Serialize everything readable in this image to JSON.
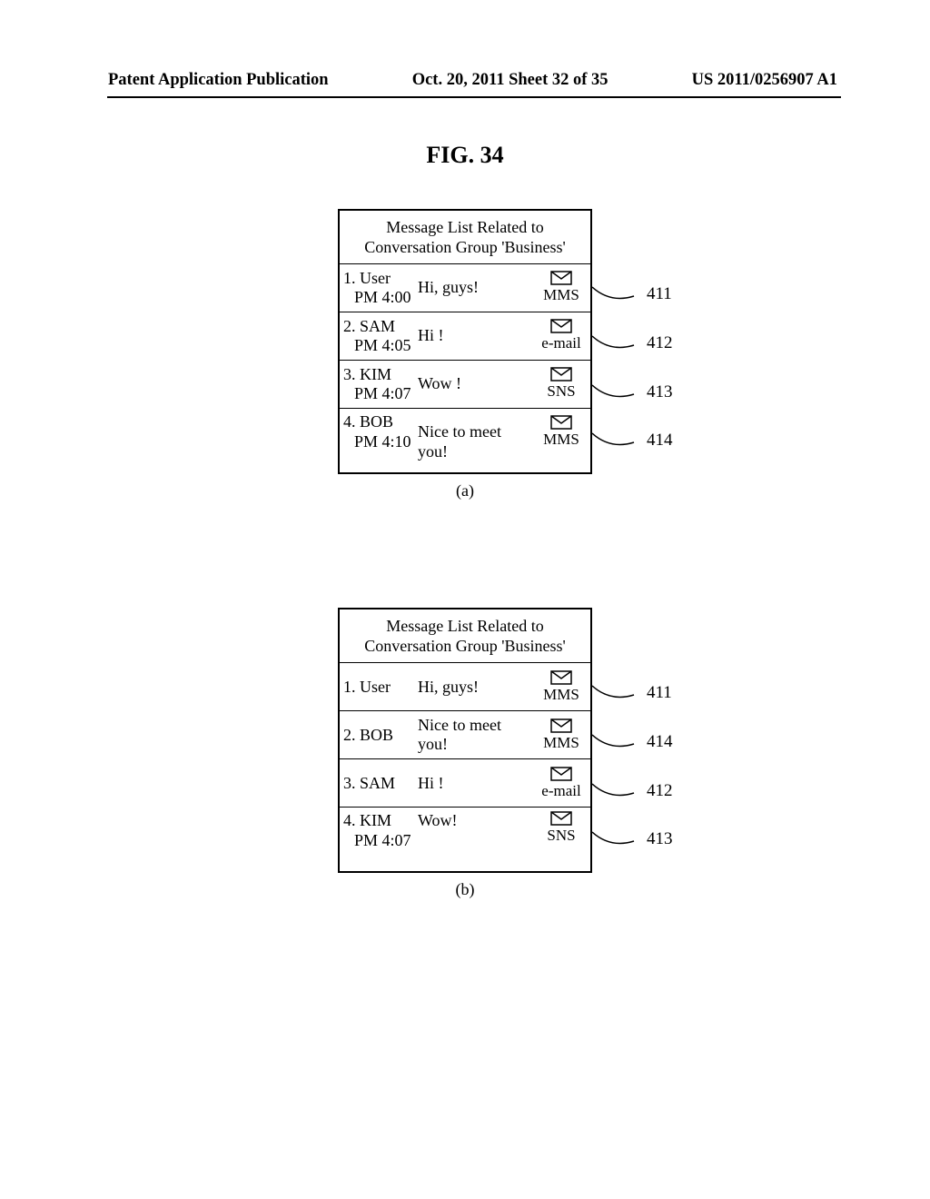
{
  "header": {
    "left": "Patent Application Publication",
    "center": "Oct. 20, 2011  Sheet 32 of 35",
    "right": "US 2011/0256907 A1"
  },
  "figure_label": "FIG. 34",
  "panels": {
    "a": {
      "title_line1": "Message List Related to",
      "title_line2": "Conversation Group 'Business'",
      "rows": [
        {
          "sender": "1. User",
          "time": "PM 4:00",
          "msg": "Hi, guys!",
          "type": "MMS",
          "ref": "411"
        },
        {
          "sender": "2. SAM",
          "time": "PM 4:05",
          "msg": "Hi !",
          "type": "e-mail",
          "ref": "412"
        },
        {
          "sender": "3. KIM",
          "time": "PM 4:07",
          "msg": "Wow !",
          "type": "SNS",
          "ref": "413"
        },
        {
          "sender": "4. BOB",
          "time": "PM 4:10",
          "msg": "Nice to meet you!",
          "type": "MMS",
          "ref": "414"
        }
      ],
      "sublabel": "(a)"
    },
    "b": {
      "title_line1": "Message List Related to",
      "title_line2": "Conversation Group 'Business'",
      "rows": [
        {
          "sender": "1. User",
          "time": "",
          "msg": "Hi, guys!",
          "type": "MMS",
          "ref": "411"
        },
        {
          "sender": "2. BOB",
          "time": "",
          "msg": "Nice to meet you!",
          "type": "MMS",
          "ref": "414"
        },
        {
          "sender": "3. SAM",
          "time": "",
          "msg": "Hi !",
          "type": "e-mail",
          "ref": "412"
        },
        {
          "sender": "4. KIM",
          "time": "PM 4:07",
          "msg": "Wow!",
          "type": "SNS",
          "ref": "413"
        }
      ],
      "sublabel": "(b)"
    }
  }
}
